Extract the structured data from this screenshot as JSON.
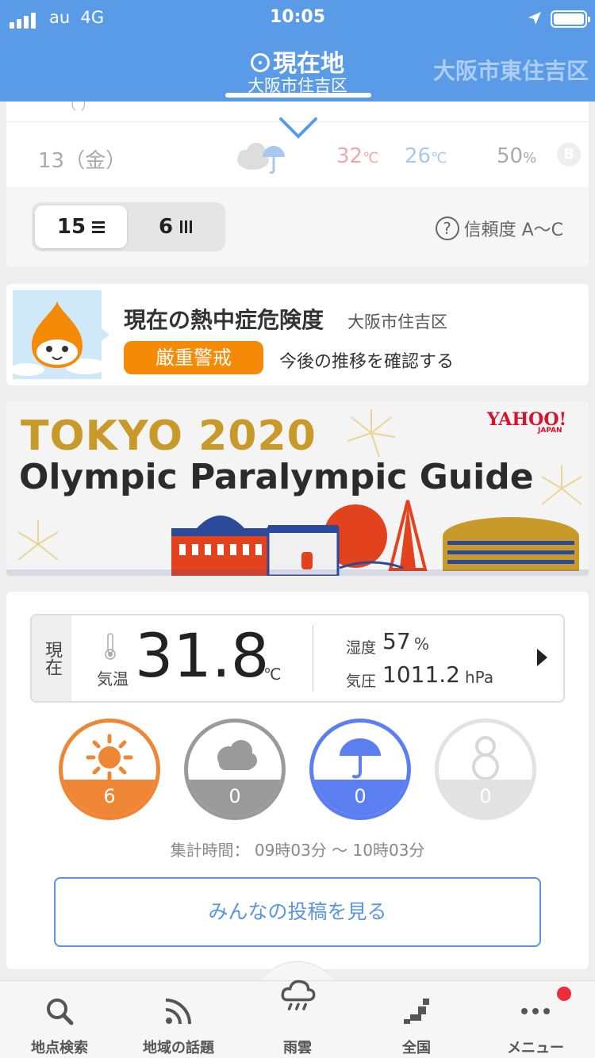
{
  "status_bar": {
    "carrier": "au",
    "network": "4G",
    "time": "10:05"
  },
  "header": {
    "title": "現在地",
    "subtitle": "大阪市住吉区",
    "next_location": "大阪市東住吉区"
  },
  "forecast": {
    "row": {
      "day": "13（金）",
      "high": "32",
      "high_unit": "℃",
      "low": "26",
      "low_unit": "℃",
      "humidity": "50",
      "humidity_unit": "%",
      "reliability": "B"
    },
    "toggle": {
      "days15": "15",
      "days6": "6"
    },
    "reliability_label": "信頼度 A〜C"
  },
  "heatstroke": {
    "title": "現在の熱中症危険度",
    "place": "大阪市住吉区",
    "level": "厳重警戒",
    "link": "今後の推移を確認する"
  },
  "banner": {
    "line1": "TOKYO 2020",
    "line2": "Olympic Paralympic Guide",
    "brand": "YAHOO!",
    "brand_sub": "JAPAN"
  },
  "current": {
    "label": "現在",
    "temp_label": "気温",
    "temp": "31.8",
    "temp_unit": "℃",
    "humidity_label": "湿度",
    "humidity": "57",
    "humidity_unit": "%",
    "pressure_label": "気圧",
    "pressure": "1011.2",
    "pressure_unit": "hPa"
  },
  "reports": {
    "sunny": "6",
    "cloudy": "0",
    "rain": "0",
    "snow": "0",
    "time_range": "集計時間： 09時03分 〜 10時03分",
    "button": "みんなの投稿を見る"
  },
  "colors": {
    "header": "#5a9be8",
    "sunny": "#ef8636",
    "cloudy": "#9a9a9a",
    "rain": "#5b7ff0",
    "snow": "#e2e2e2",
    "warning": "#f58a07"
  },
  "bottom_nav": [
    {
      "label": "地点検索",
      "icon": "search-icon"
    },
    {
      "label": "地域の話題",
      "icon": "rss-icon"
    },
    {
      "label": "雨雲",
      "icon": "rain-cloud-icon"
    },
    {
      "label": "全国",
      "icon": "japan-map-icon"
    },
    {
      "label": "メニュー",
      "icon": "more-icon"
    }
  ]
}
